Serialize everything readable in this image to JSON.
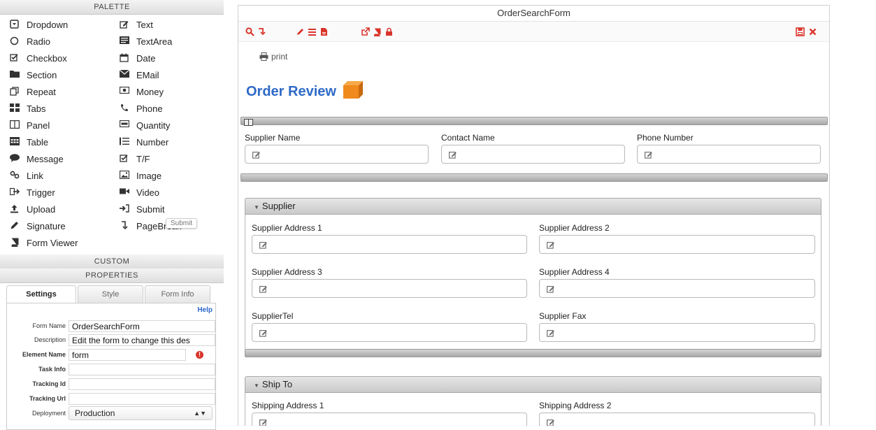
{
  "palette": {
    "title": "PALETTE",
    "items": [
      {
        "label": "Dropdown",
        "icon": "dropdown-icon"
      },
      {
        "label": "Text",
        "icon": "text-edit-icon"
      },
      {
        "label": "Radio",
        "icon": "radio-icon"
      },
      {
        "label": "TextArea",
        "icon": "textarea-icon"
      },
      {
        "label": "Checkbox",
        "icon": "checkbox-icon"
      },
      {
        "label": "Date",
        "icon": "calendar-icon"
      },
      {
        "label": "Section",
        "icon": "folder-icon"
      },
      {
        "label": "EMail",
        "icon": "envelope-icon"
      },
      {
        "label": "Repeat",
        "icon": "repeat-icon"
      },
      {
        "label": "Money",
        "icon": "money-icon"
      },
      {
        "label": "Tabs",
        "icon": "tabs-icon"
      },
      {
        "label": "Phone",
        "icon": "phone-icon"
      },
      {
        "label": "Panel",
        "icon": "panel-icon"
      },
      {
        "label": "Quantity",
        "icon": "quantity-icon"
      },
      {
        "label": "Table",
        "icon": "table-icon"
      },
      {
        "label": "Number",
        "icon": "number-list-icon"
      },
      {
        "label": "Message",
        "icon": "comment-icon"
      },
      {
        "label": "T/F",
        "icon": "checkbox-checked-icon"
      },
      {
        "label": "Link",
        "icon": "link-icon"
      },
      {
        "label": "Image",
        "icon": "image-icon"
      },
      {
        "label": "Trigger",
        "icon": "trigger-icon"
      },
      {
        "label": "Video",
        "icon": "video-icon"
      },
      {
        "label": "Upload",
        "icon": "upload-icon"
      },
      {
        "label": "Submit",
        "icon": "sign-in-icon"
      },
      {
        "label": "Signature",
        "icon": "pencil-icon"
      },
      {
        "label": "PageBreak",
        "icon": "page-break-icon"
      },
      {
        "label": "Form Viewer",
        "icon": "book-icon"
      }
    ],
    "tooltip": "Submit"
  },
  "custom": {
    "title": "CUSTOM"
  },
  "properties": {
    "title": "PROPERTIES",
    "tabs": [
      "Settings",
      "Style",
      "Form Info"
    ],
    "active_tab": "Settings",
    "help": "Help",
    "fields": {
      "form_name": {
        "label": "Form Name",
        "value": "OrderSearchForm"
      },
      "description": {
        "label": "Description",
        "value": "Edit the form to change this des"
      },
      "element_name": {
        "label": "Element Name",
        "value": "form"
      },
      "task_info": {
        "label": "Task Info",
        "value": ""
      },
      "tracking_id": {
        "label": "Tracking Id",
        "value": ""
      },
      "tracking_url": {
        "label": "Tracking Url",
        "value": ""
      },
      "deployment": {
        "label": "Deployment",
        "value": "Production"
      }
    }
  },
  "form": {
    "title": "OrderSearchForm",
    "print_label": "print",
    "heading": "Order Review",
    "top_fields": {
      "supplier_name": "Supplier Name",
      "contact_name": "Contact Name",
      "phone_number": "Phone Number"
    },
    "supplier_section": {
      "title": "Supplier",
      "fields": {
        "address1": "Supplier Address 1",
        "address2": "Supplier Address 2",
        "address3": "Supplier Address 3",
        "address4": "Supplier Address 4",
        "tel": "SupplierTel",
        "fax": "Supplier Fax"
      }
    },
    "shipto_section": {
      "title": "Ship To",
      "fields": {
        "address1": "Shipping Address 1",
        "address2": "Shipping Address 2"
      }
    }
  },
  "colors": {
    "toolbar_icon": "#d9342b",
    "heading": "#2f6ac7",
    "logo_orange": "#f08a1c"
  }
}
